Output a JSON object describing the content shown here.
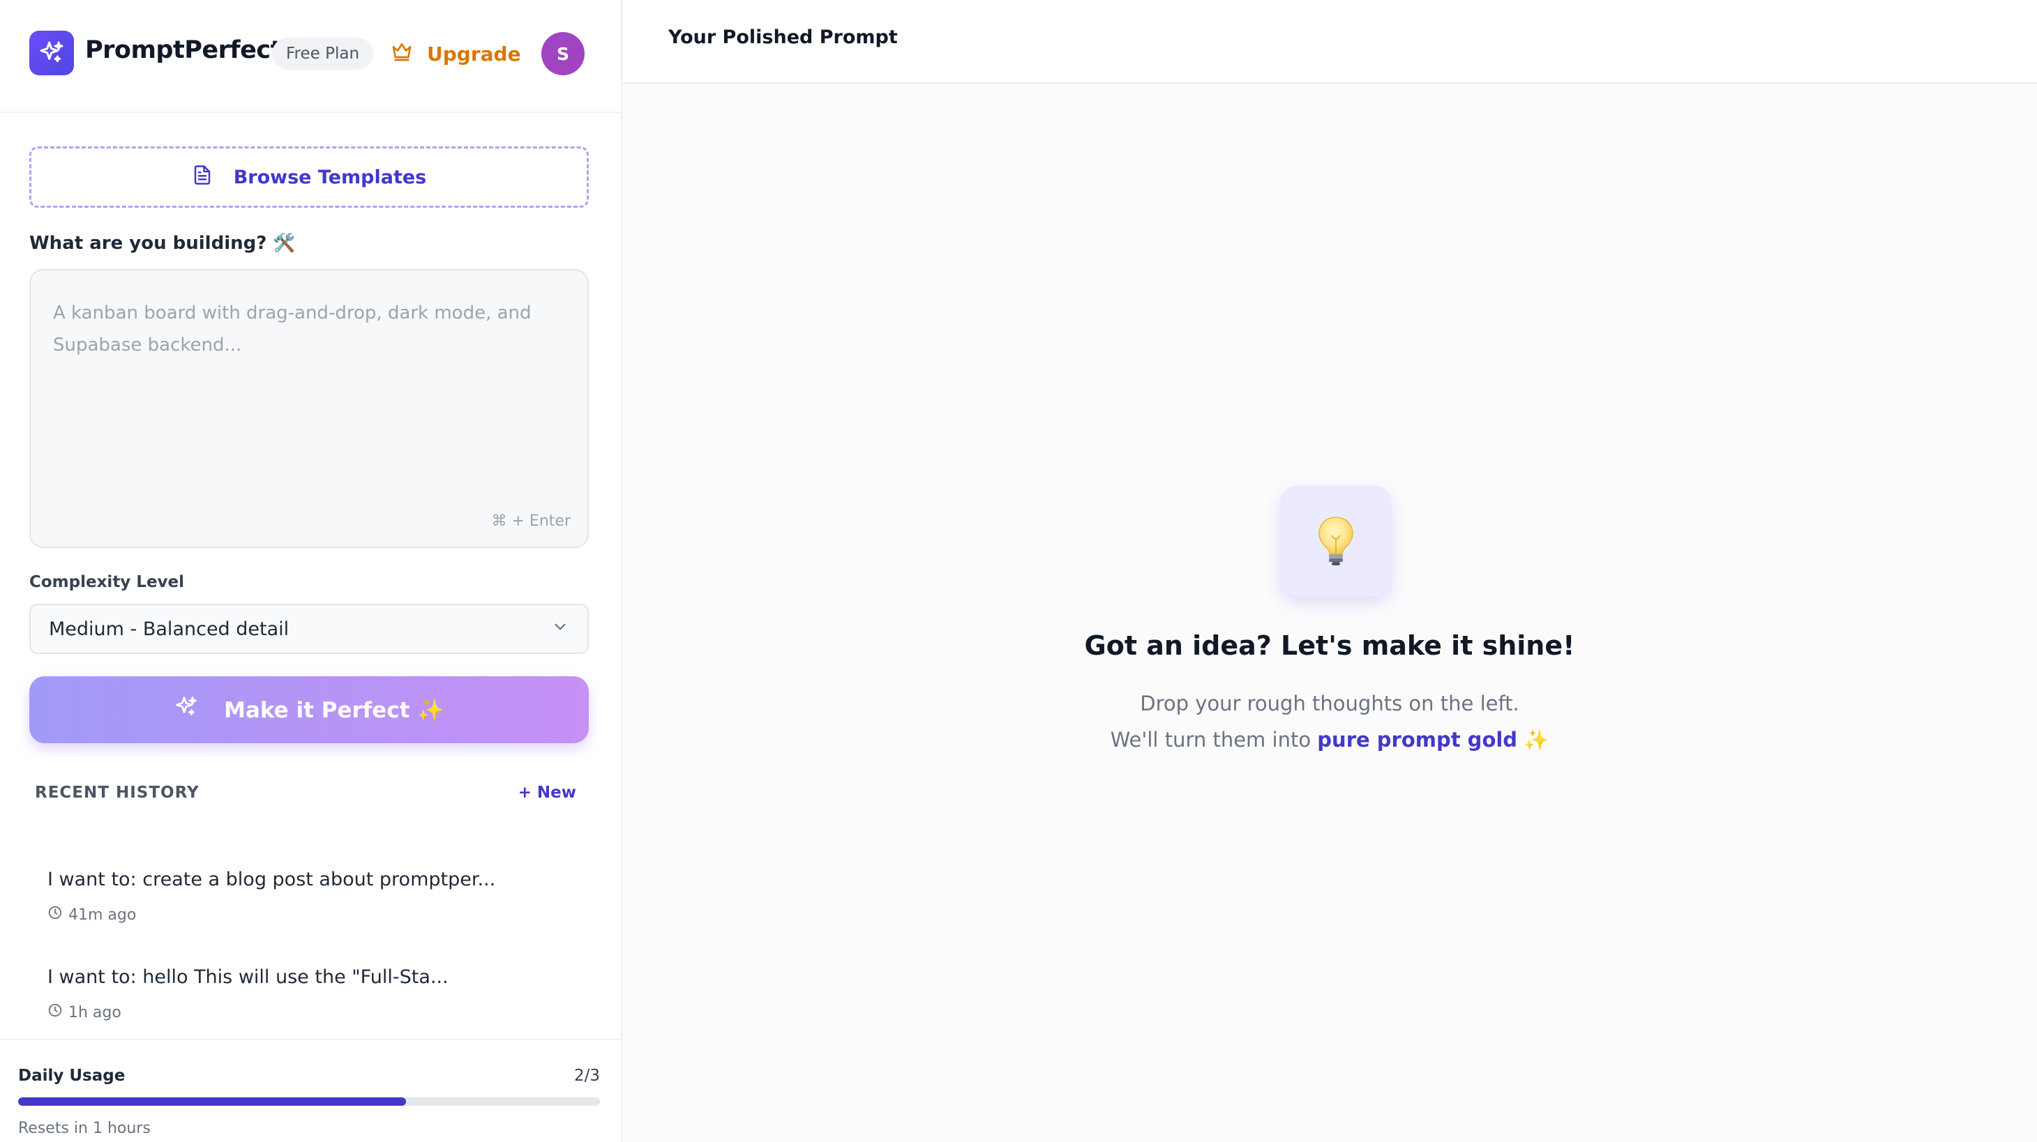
{
  "header": {
    "brand": "PromptPerfect",
    "plan": "Free Plan",
    "upgrade_label": "Upgrade",
    "avatar_initial": "S"
  },
  "sidebar": {
    "browse_templates_label": "Browse Templates",
    "prompt_label": "What are you building? 🛠️",
    "prompt_placeholder": "A kanban board with drag-and-drop, dark mode, and Supabase backend...",
    "prompt_value": "",
    "shortcut_hint": "⌘ + Enter",
    "complexity_label": "Complexity Level",
    "complexity_selected": "Medium - Balanced detail",
    "make_button_label": "Make it Perfect ✨",
    "history_title": "RECENT HISTORY",
    "history_new_label": "+ New",
    "history": [
      {
        "title": "I want to: create a blog post about promptper...",
        "time": "41m ago"
      },
      {
        "title": "I want to: hello This will use the \"Full-Sta...",
        "time": "1h ago"
      }
    ],
    "usage": {
      "label": "Daily Usage",
      "count": "2/3",
      "fraction": 0.6667,
      "reset_text": "Resets in 1 hours"
    }
  },
  "main": {
    "title": "Your Polished Prompt",
    "empty_title": "Got an idea? Let's make it shine!",
    "empty_line1": "Drop your rough thoughts on the left.",
    "empty_line2_prefix": "We'll turn them into ",
    "empty_line2_accent": "pure prompt gold",
    "empty_line2_suffix": " ✨"
  },
  "colors": {
    "accent": "#4338ca",
    "upgrade": "#d97706",
    "avatar": "#a044c2",
    "button_gradient_start": "#a29af7",
    "button_gradient_end": "#c690f5"
  }
}
